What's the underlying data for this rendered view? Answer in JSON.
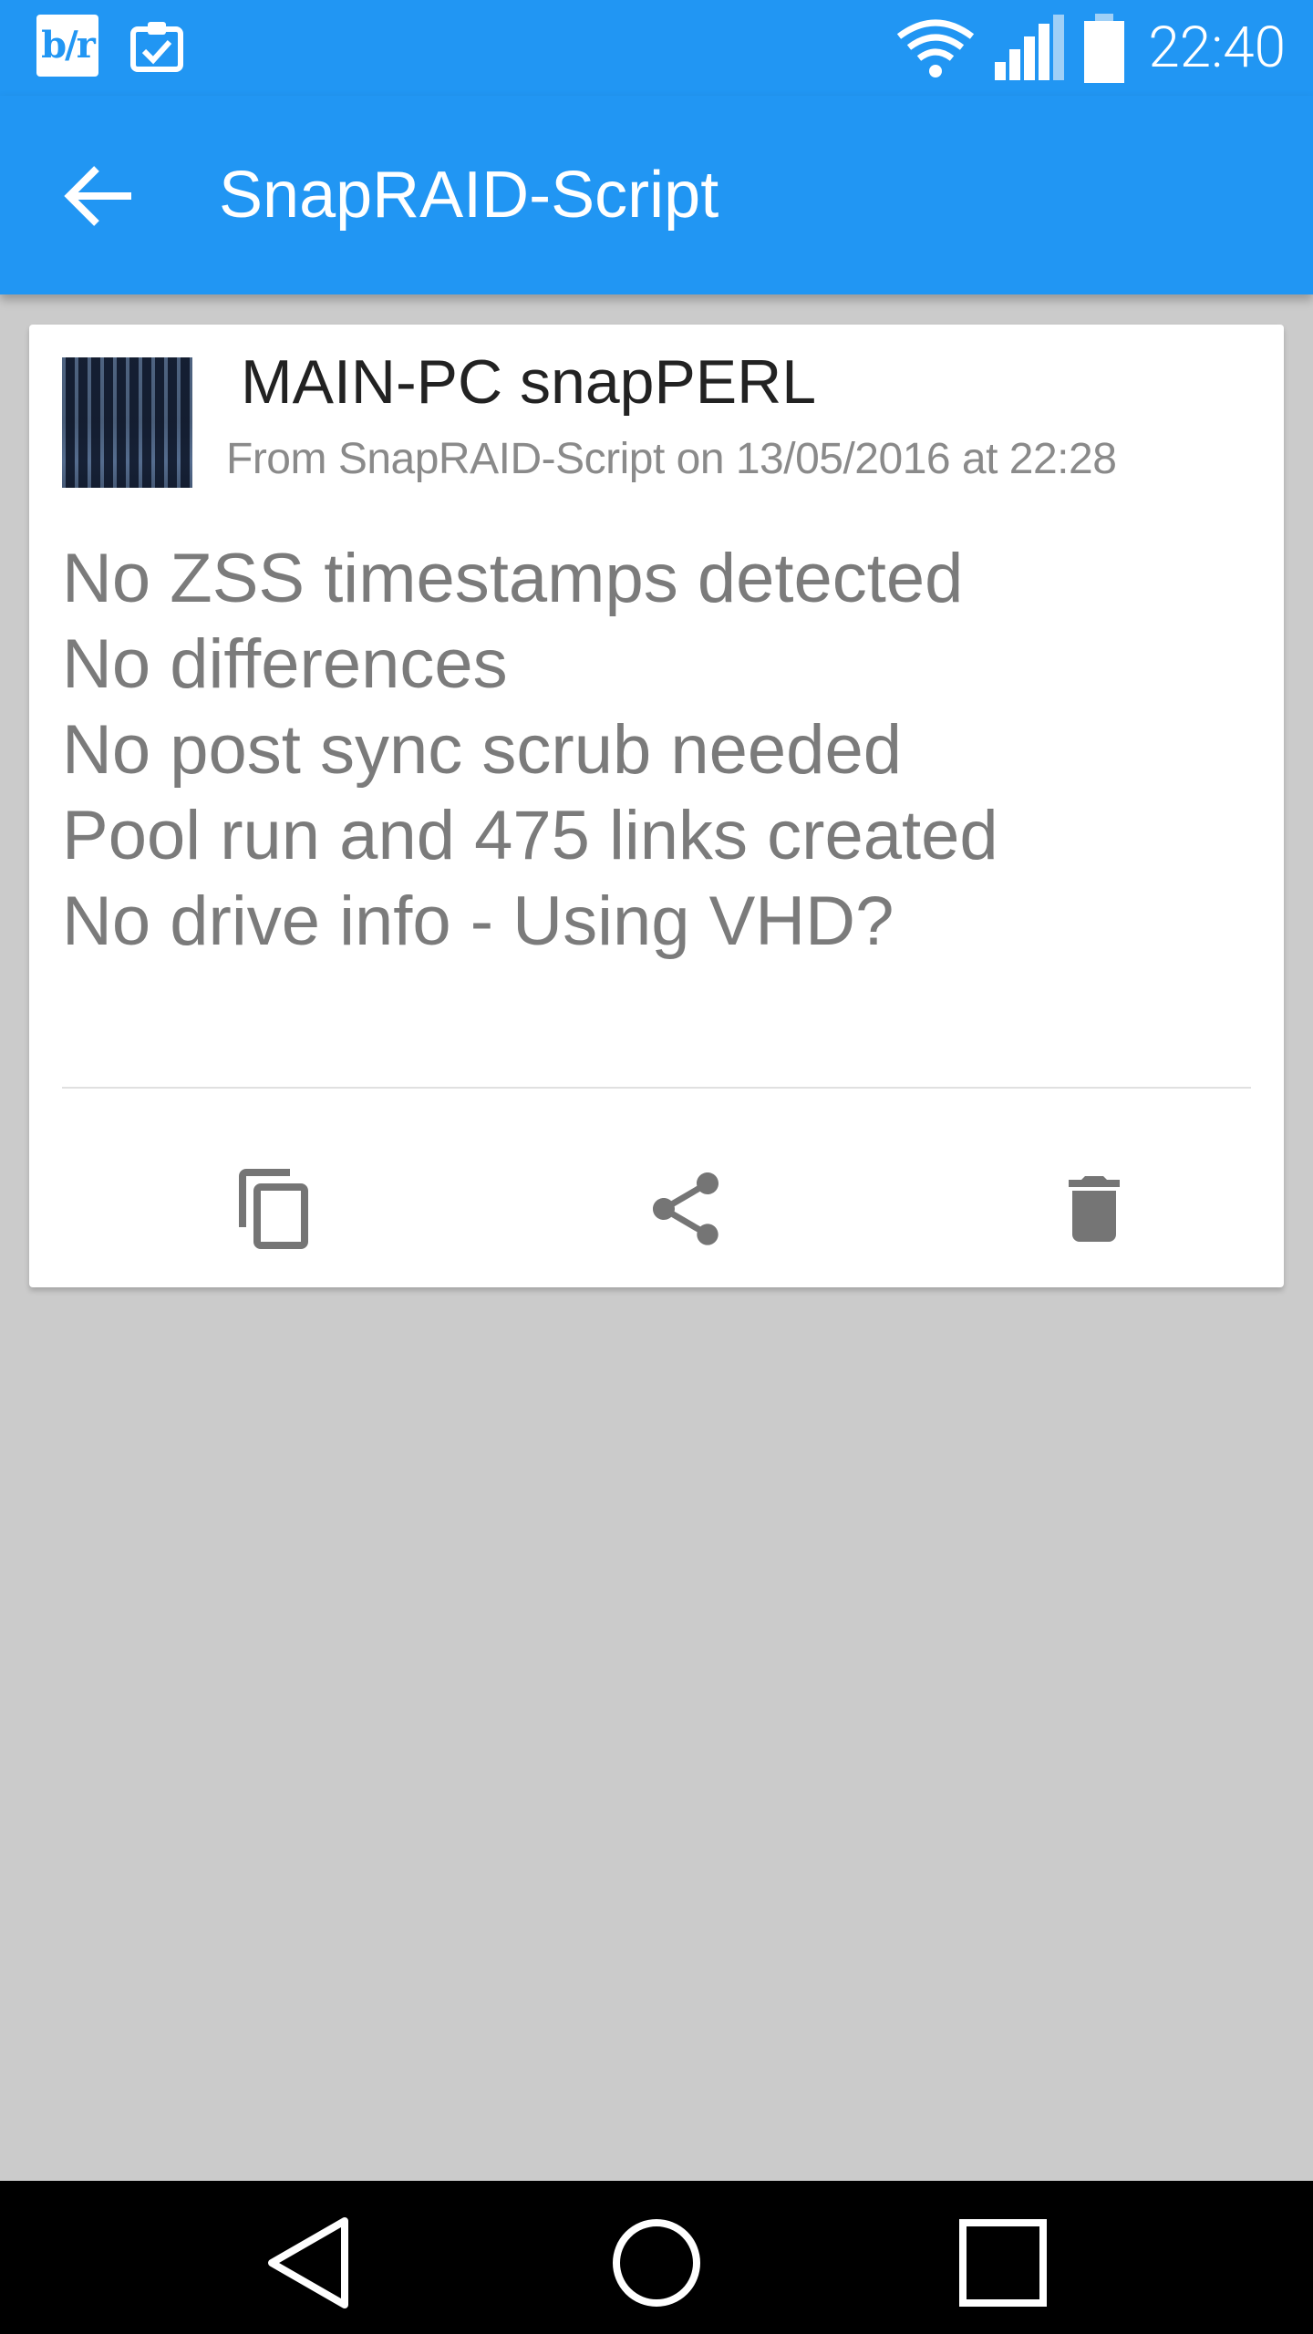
{
  "status_bar": {
    "app_badge": "b/r",
    "time": "22:40",
    "icons": [
      "bleacher-report-icon",
      "clipboard-check-icon",
      "wifi-icon",
      "signal-icon",
      "battery-icon"
    ]
  },
  "app_bar": {
    "title": "SnapRAID-Script",
    "back_icon": "arrow-back-icon"
  },
  "message": {
    "title": "MAIN-PC snapPERL",
    "subtitle": "From SnapRAID-Script on 13/05/2016 at 22:28",
    "lines": [
      "No ZSS timestamps detected",
      "No differences",
      "No post sync scrub needed",
      "Pool run and 475 links created",
      "No drive info - Using VHD?"
    ],
    "actions": [
      "copy-icon",
      "share-icon",
      "delete-icon"
    ]
  },
  "nav_bar": {
    "buttons": [
      "back-triangle-icon",
      "home-circle-icon",
      "recents-square-icon"
    ]
  },
  "colors": {
    "primary": "#2196f3",
    "background": "#cbcbcb",
    "card": "#ffffff",
    "body_text": "#7b7b7b",
    "icon": "#757575"
  }
}
